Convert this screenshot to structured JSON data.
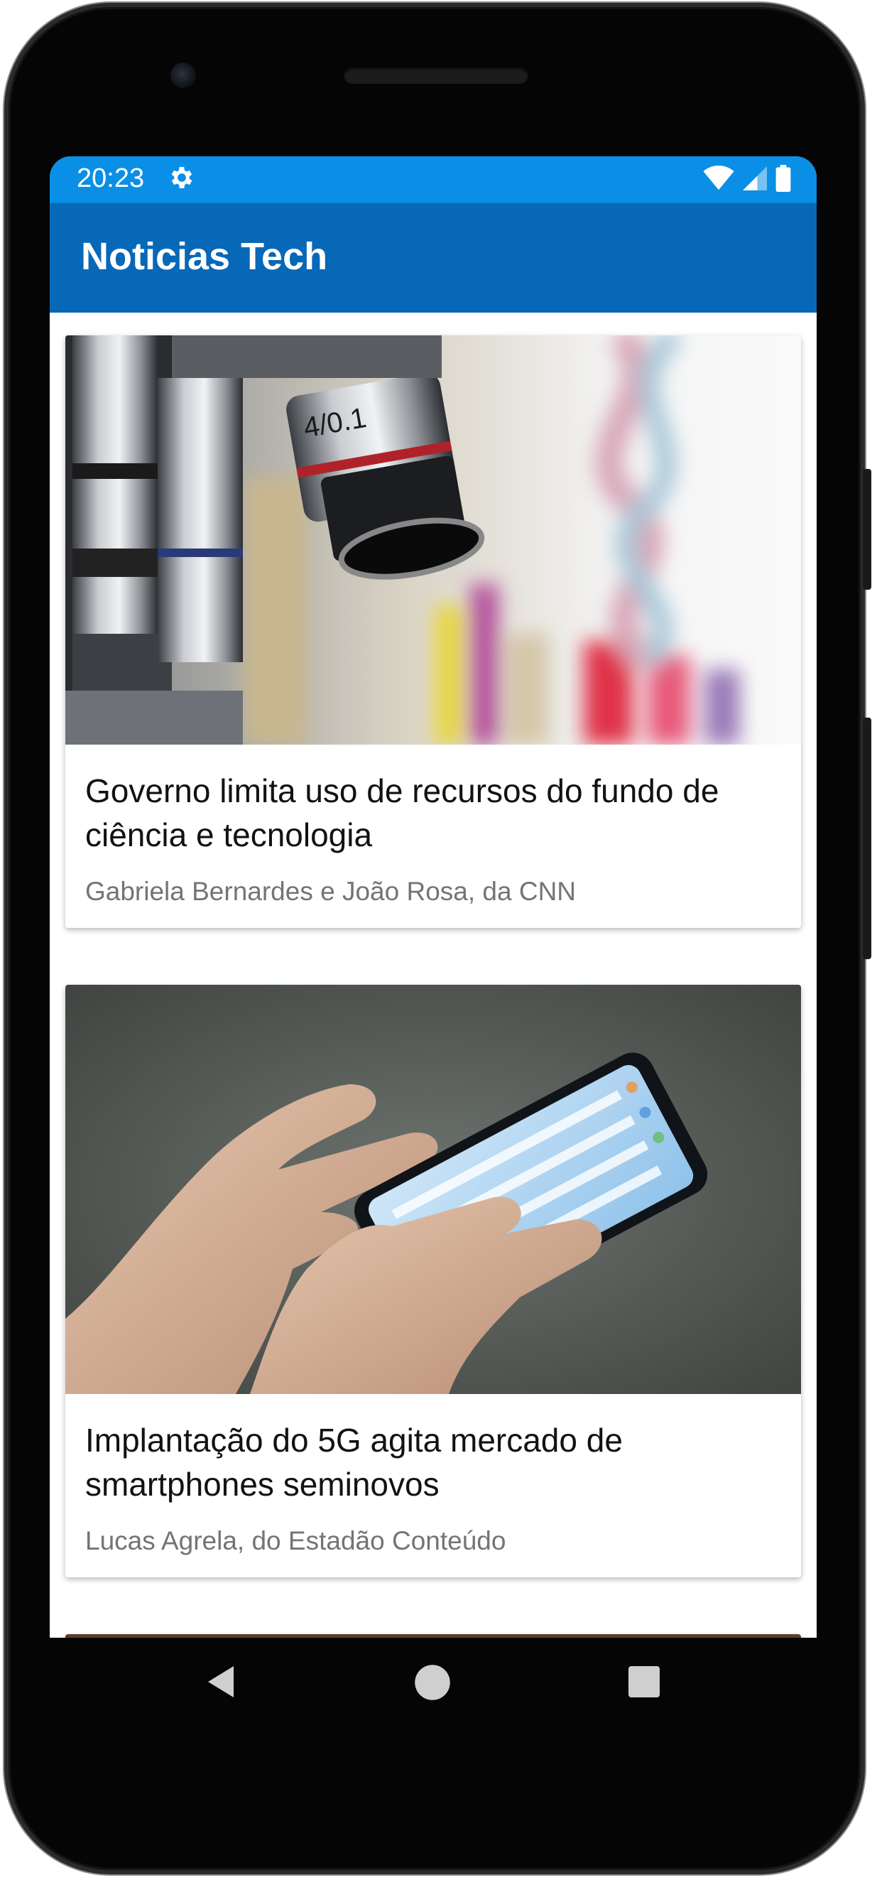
{
  "status_bar": {
    "time": "20:23",
    "icons": [
      "settings-gear-icon",
      "wifi-icon",
      "signal-icon",
      "battery-icon"
    ],
    "color": "#0a8fe6"
  },
  "app_bar": {
    "title": "Noticias Tech",
    "color": "#0868b8"
  },
  "articles": [
    {
      "title": "Governo limita uso de recursos do fundo de ciência e tecnologia",
      "author": "Gabriela Bernardes e João Rosa, da CNN",
      "image": "microscope-dna-photo"
    },
    {
      "title": "Implantação do 5G agita mercado de smartphones seminovos",
      "author": "Lucas Agrela, do Estadão Conteúdo",
      "image": "hands-holding-smartphone-photo"
    }
  ],
  "navigation": {
    "buttons": [
      "back-icon",
      "home-icon",
      "recents-icon"
    ]
  }
}
